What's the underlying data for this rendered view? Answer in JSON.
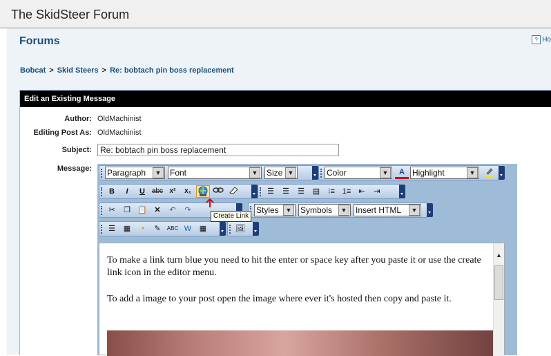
{
  "site_title": "The SkidSteer Forum",
  "page_title": "Forums",
  "help_link": "Ho",
  "breadcrumb": [
    "Bobcat",
    "Skid Steers",
    "Re: bobtach pin boss replacement"
  ],
  "form": {
    "header": "Edit an Existing Message",
    "author_label": "Author:",
    "author_value": "OldMachinist",
    "editing_as_label": "Editing Post As:",
    "editing_as_value": "OldMachinist",
    "subject_label": "Subject:",
    "subject_value": "Re: bobtach pin boss replacement",
    "message_label": "Message:"
  },
  "toolbar": {
    "paragraph": "Paragraph",
    "font": "Font",
    "size": "Size",
    "color": "Color",
    "highlight": "Highlight",
    "styles": "Styles",
    "symbols": "Symbols",
    "insert_html": "Insert HTML",
    "bold": "B",
    "italic": "I",
    "underline": "U",
    "strike": "abc",
    "superscript": "x²",
    "subscript": "x₁",
    "tooltip": "Create Link"
  },
  "editor_text": {
    "para1": "To make a link turn blue you need to hit the enter or space key after you paste it or use the create link icon in the editor menu.",
    "para2": "To add a image to your post open the image where ever it's hosted then copy and paste it."
  },
  "colors": {
    "link": "#1a4f7a",
    "header_bg": "#000000",
    "editor_bg": "#9ebbd7",
    "toolbar_end": "#1e3c78"
  }
}
